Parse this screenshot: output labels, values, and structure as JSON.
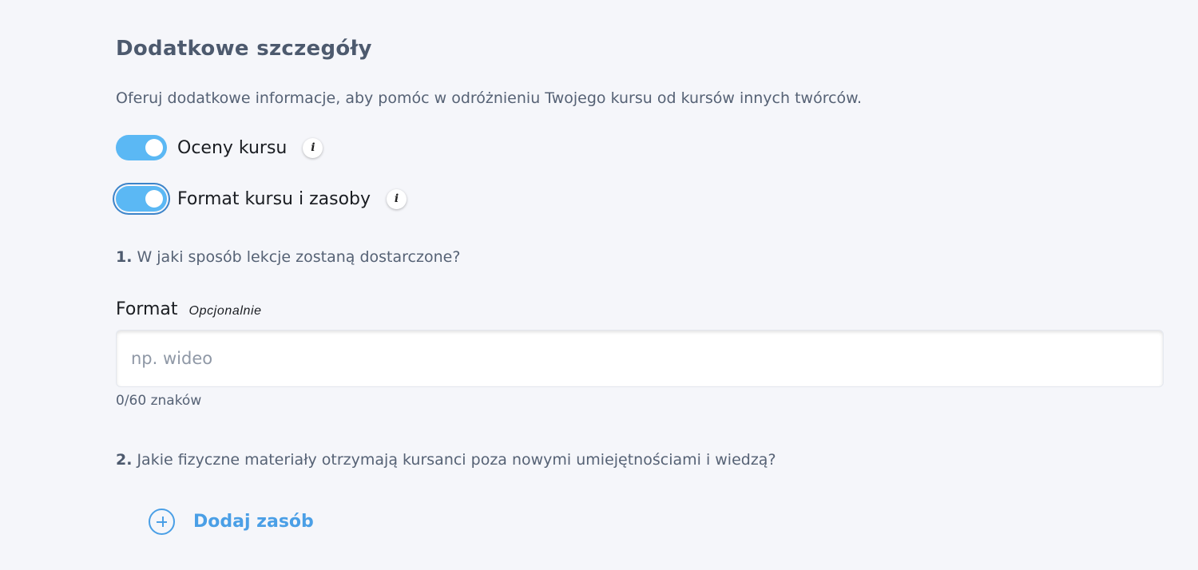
{
  "section": {
    "title": "Dodatkowe szczegóły",
    "description": "Oferuj dodatkowe informacje, aby pomóc w odróżnieniu Twojego kursu od kursów innych twórców."
  },
  "toggles": [
    {
      "label": "Oceny kursu",
      "enabled": true,
      "icon": "info-icon"
    },
    {
      "label": "Format kursu i zasoby",
      "enabled": true,
      "focused": true,
      "icon": "info-icon"
    }
  ],
  "info_glyph": "i",
  "questions": [
    {
      "number": "1.",
      "text": "W jaki sposób lekcje zostaną dostarczone?"
    },
    {
      "number": "2.",
      "text": "Jakie fizyczne materiały otrzymają kursanci poza nowymi umiejętnościami i wiedzą?"
    }
  ],
  "format_field": {
    "label": "Format",
    "optional_tag": "Opcjonalnie",
    "value": "",
    "placeholder": "np. wideo",
    "char_count": "0/60 znaków"
  },
  "add_resource": {
    "label": "Dodaj zasób",
    "icon": "plus-circle-icon"
  },
  "colors": {
    "background": "#f5f6fa",
    "toggle_on": "#5bb8f4",
    "focus_ring": "#3c84c9",
    "link_blue": "#4a9fe6",
    "heading": "#4d5a6e"
  }
}
